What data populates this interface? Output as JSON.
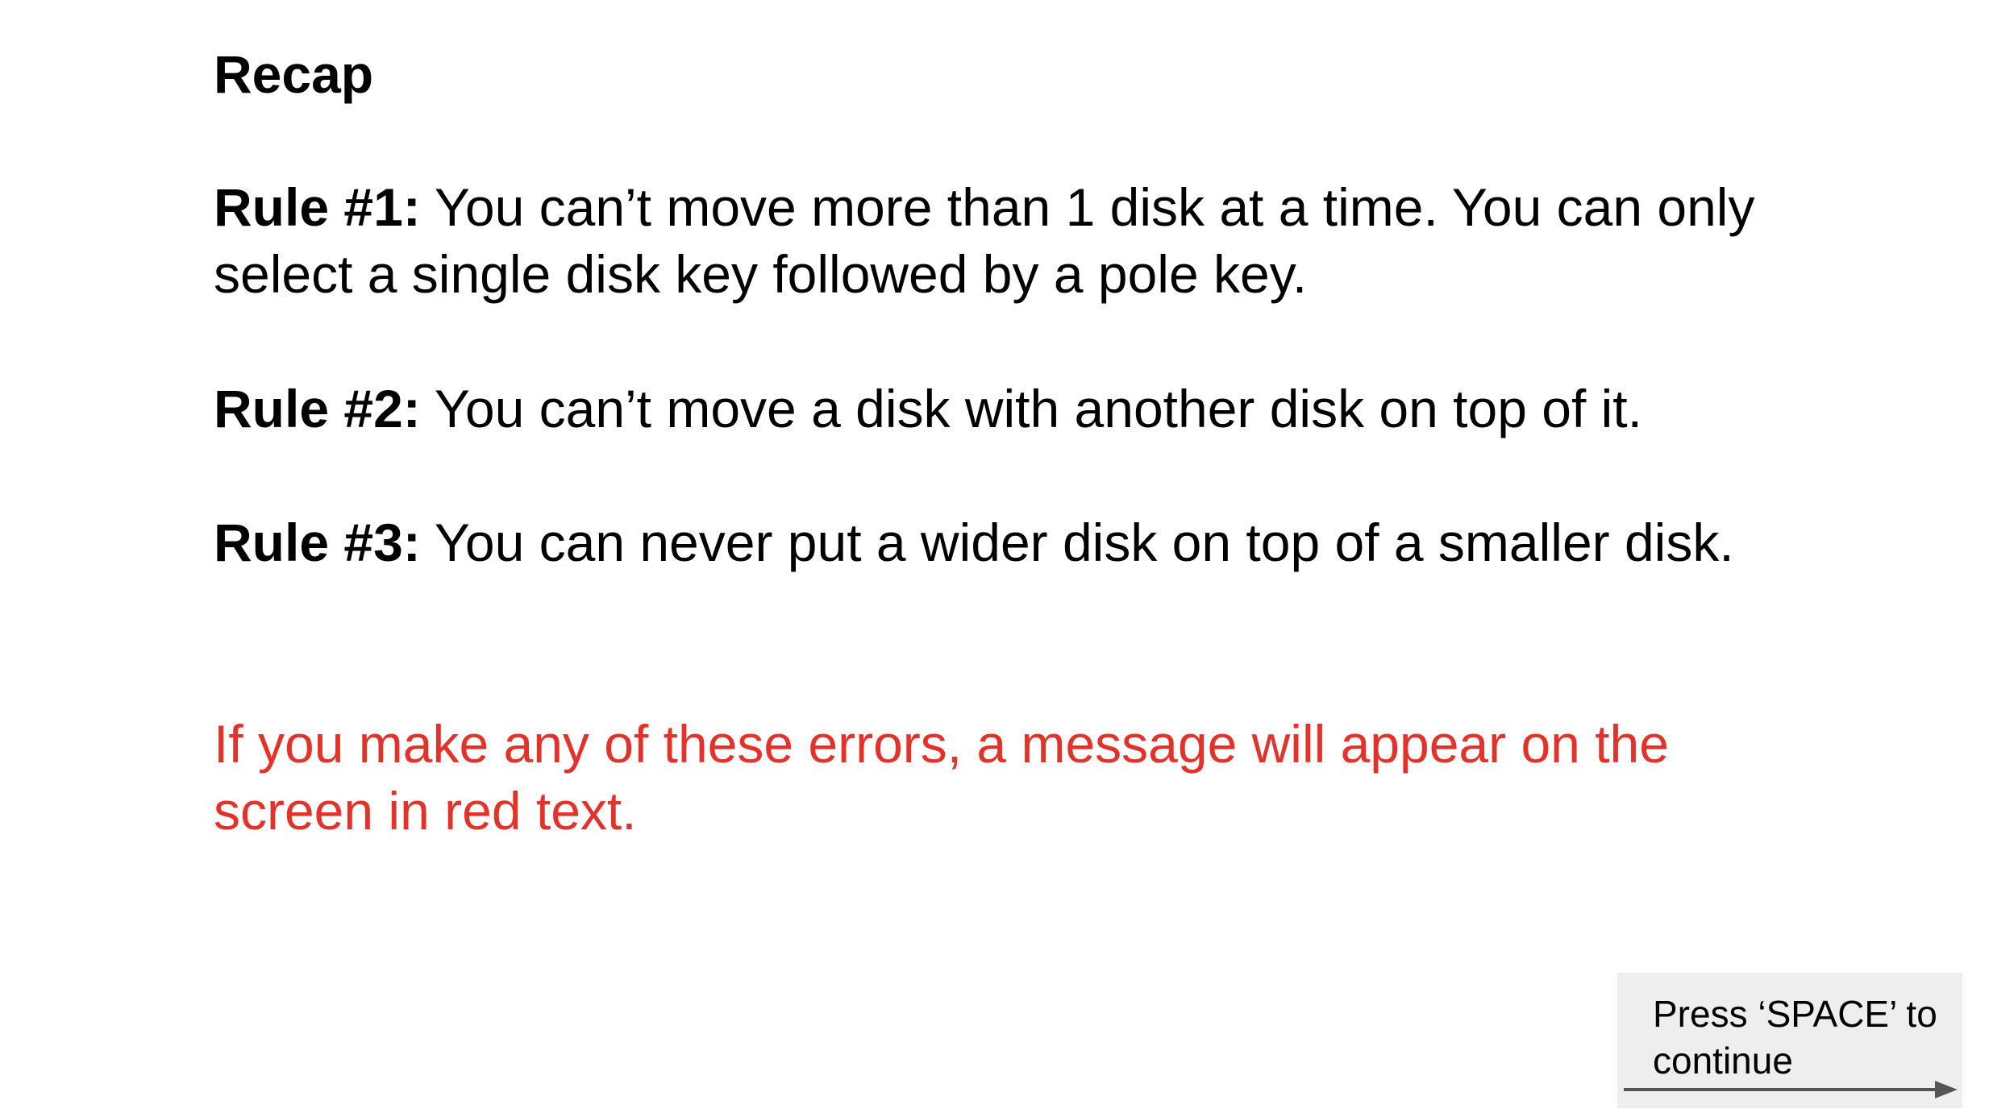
{
  "slide": {
    "title": "Recap",
    "rules": [
      {
        "label": "Rule #1:",
        "text": " You can’t move more than 1 disk at a time. You can only select a single disk key followed by a pole key."
      },
      {
        "label": "Rule #2:",
        "text": " You can’t move a disk with another disk on top of it."
      },
      {
        "label": "Rule #3:",
        "text": " You can never put a wider disk on top of a smaller disk."
      }
    ],
    "warning": "If you make any of these errors, a message will appear on the screen in red text.",
    "continue_prompt": "Press ‘SPACE’ to continue"
  },
  "colors": {
    "warning": "#e2322a",
    "continue_box_bg": "#eeeeee",
    "arrow": "#555555"
  },
  "icons": {
    "continue_arrow": "right-arrow-icon"
  }
}
